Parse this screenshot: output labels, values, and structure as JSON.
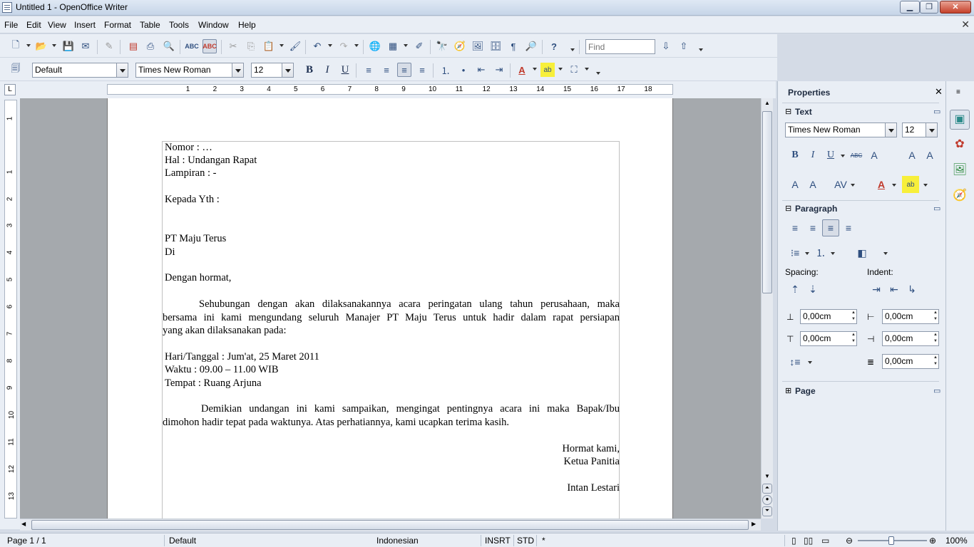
{
  "window": {
    "title": "Untitled 1 - OpenOffice Writer"
  },
  "menu": [
    "File",
    "Edit",
    "View",
    "Insert",
    "Format",
    "Table",
    "Tools",
    "Window",
    "Help"
  ],
  "find": {
    "placeholder": "Find"
  },
  "format": {
    "style": "Default",
    "font": "Times New Roman",
    "size": "12"
  },
  "ruler": {
    "h_marks": [
      "1",
      "2",
      "3",
      "4",
      "5",
      "6",
      "7",
      "8",
      "9",
      "10",
      "11",
      "12",
      "13",
      "14",
      "15",
      "16",
      "17",
      "18"
    ],
    "v_marks": [
      "1",
      "1",
      "2",
      "3",
      "4",
      "5",
      "6",
      "7",
      "8",
      "9",
      "10",
      "11",
      "12",
      "13"
    ]
  },
  "document": {
    "lines": [
      {
        "text": "Nomor       : …"
      },
      {
        "text": "Hal           : Undangan Rapat"
      },
      {
        "text": "Lampiran   : -"
      },
      {
        "text": "Kepada Yth :"
      },
      {
        "text": "PT Maju Terus"
      },
      {
        "text": "Di"
      },
      {
        "text": "Dengan hormat,"
      },
      {
        "text": "Sehubungan dengan akan dilaksanakannya acara peringatan ulang tahun perusahaan, maka"
      },
      {
        "text": "bersama ini kami mengundang seluruh Manajer PT Maju Terus untuk hadir dalam rapat persiapan"
      },
      {
        "text": "yang akan dilaksanakan pada:"
      },
      {
        "text": "Hari/Tanggal  : Jum'at, 25 Maret 2011"
      },
      {
        "text": "Waktu            : 09.00 – 11.00 WIB"
      },
      {
        "text": "Tempat          : Ruang Arjuna"
      },
      {
        "text": "Demikian undangan ini kami sampaikan, mengingat pentingnya acara ini maka Bapak/Ibu"
      },
      {
        "text": "dimohon hadir tepat pada waktunya. Atas perhatiannya, kami ucapkan terima kasih."
      },
      {
        "text": "Hormat kami,"
      },
      {
        "text": "Ketua Panitia"
      },
      {
        "text": "Intan Lestari"
      }
    ]
  },
  "sidebar": {
    "title": "Properties",
    "text_section": "Text",
    "font": "Times New Roman",
    "size": "12",
    "paragraph_section": "Paragraph",
    "spacing_label": "Spacing:",
    "indent_label": "Indent:",
    "above": "0,00cm",
    "before": "0,00cm",
    "below": "0,00cm",
    "after": "0,00cm",
    "first_line": "0,00cm",
    "page_section": "Page"
  },
  "status": {
    "page": "Page 1 / 1",
    "style": "Default",
    "language": "Indonesian",
    "insert": "INSRT",
    "sel": "STD",
    "modified": "*",
    "zoom": "100%"
  },
  "colors": {
    "accent": "#2f4f7f",
    "page_bg": "#a5a9ad"
  }
}
